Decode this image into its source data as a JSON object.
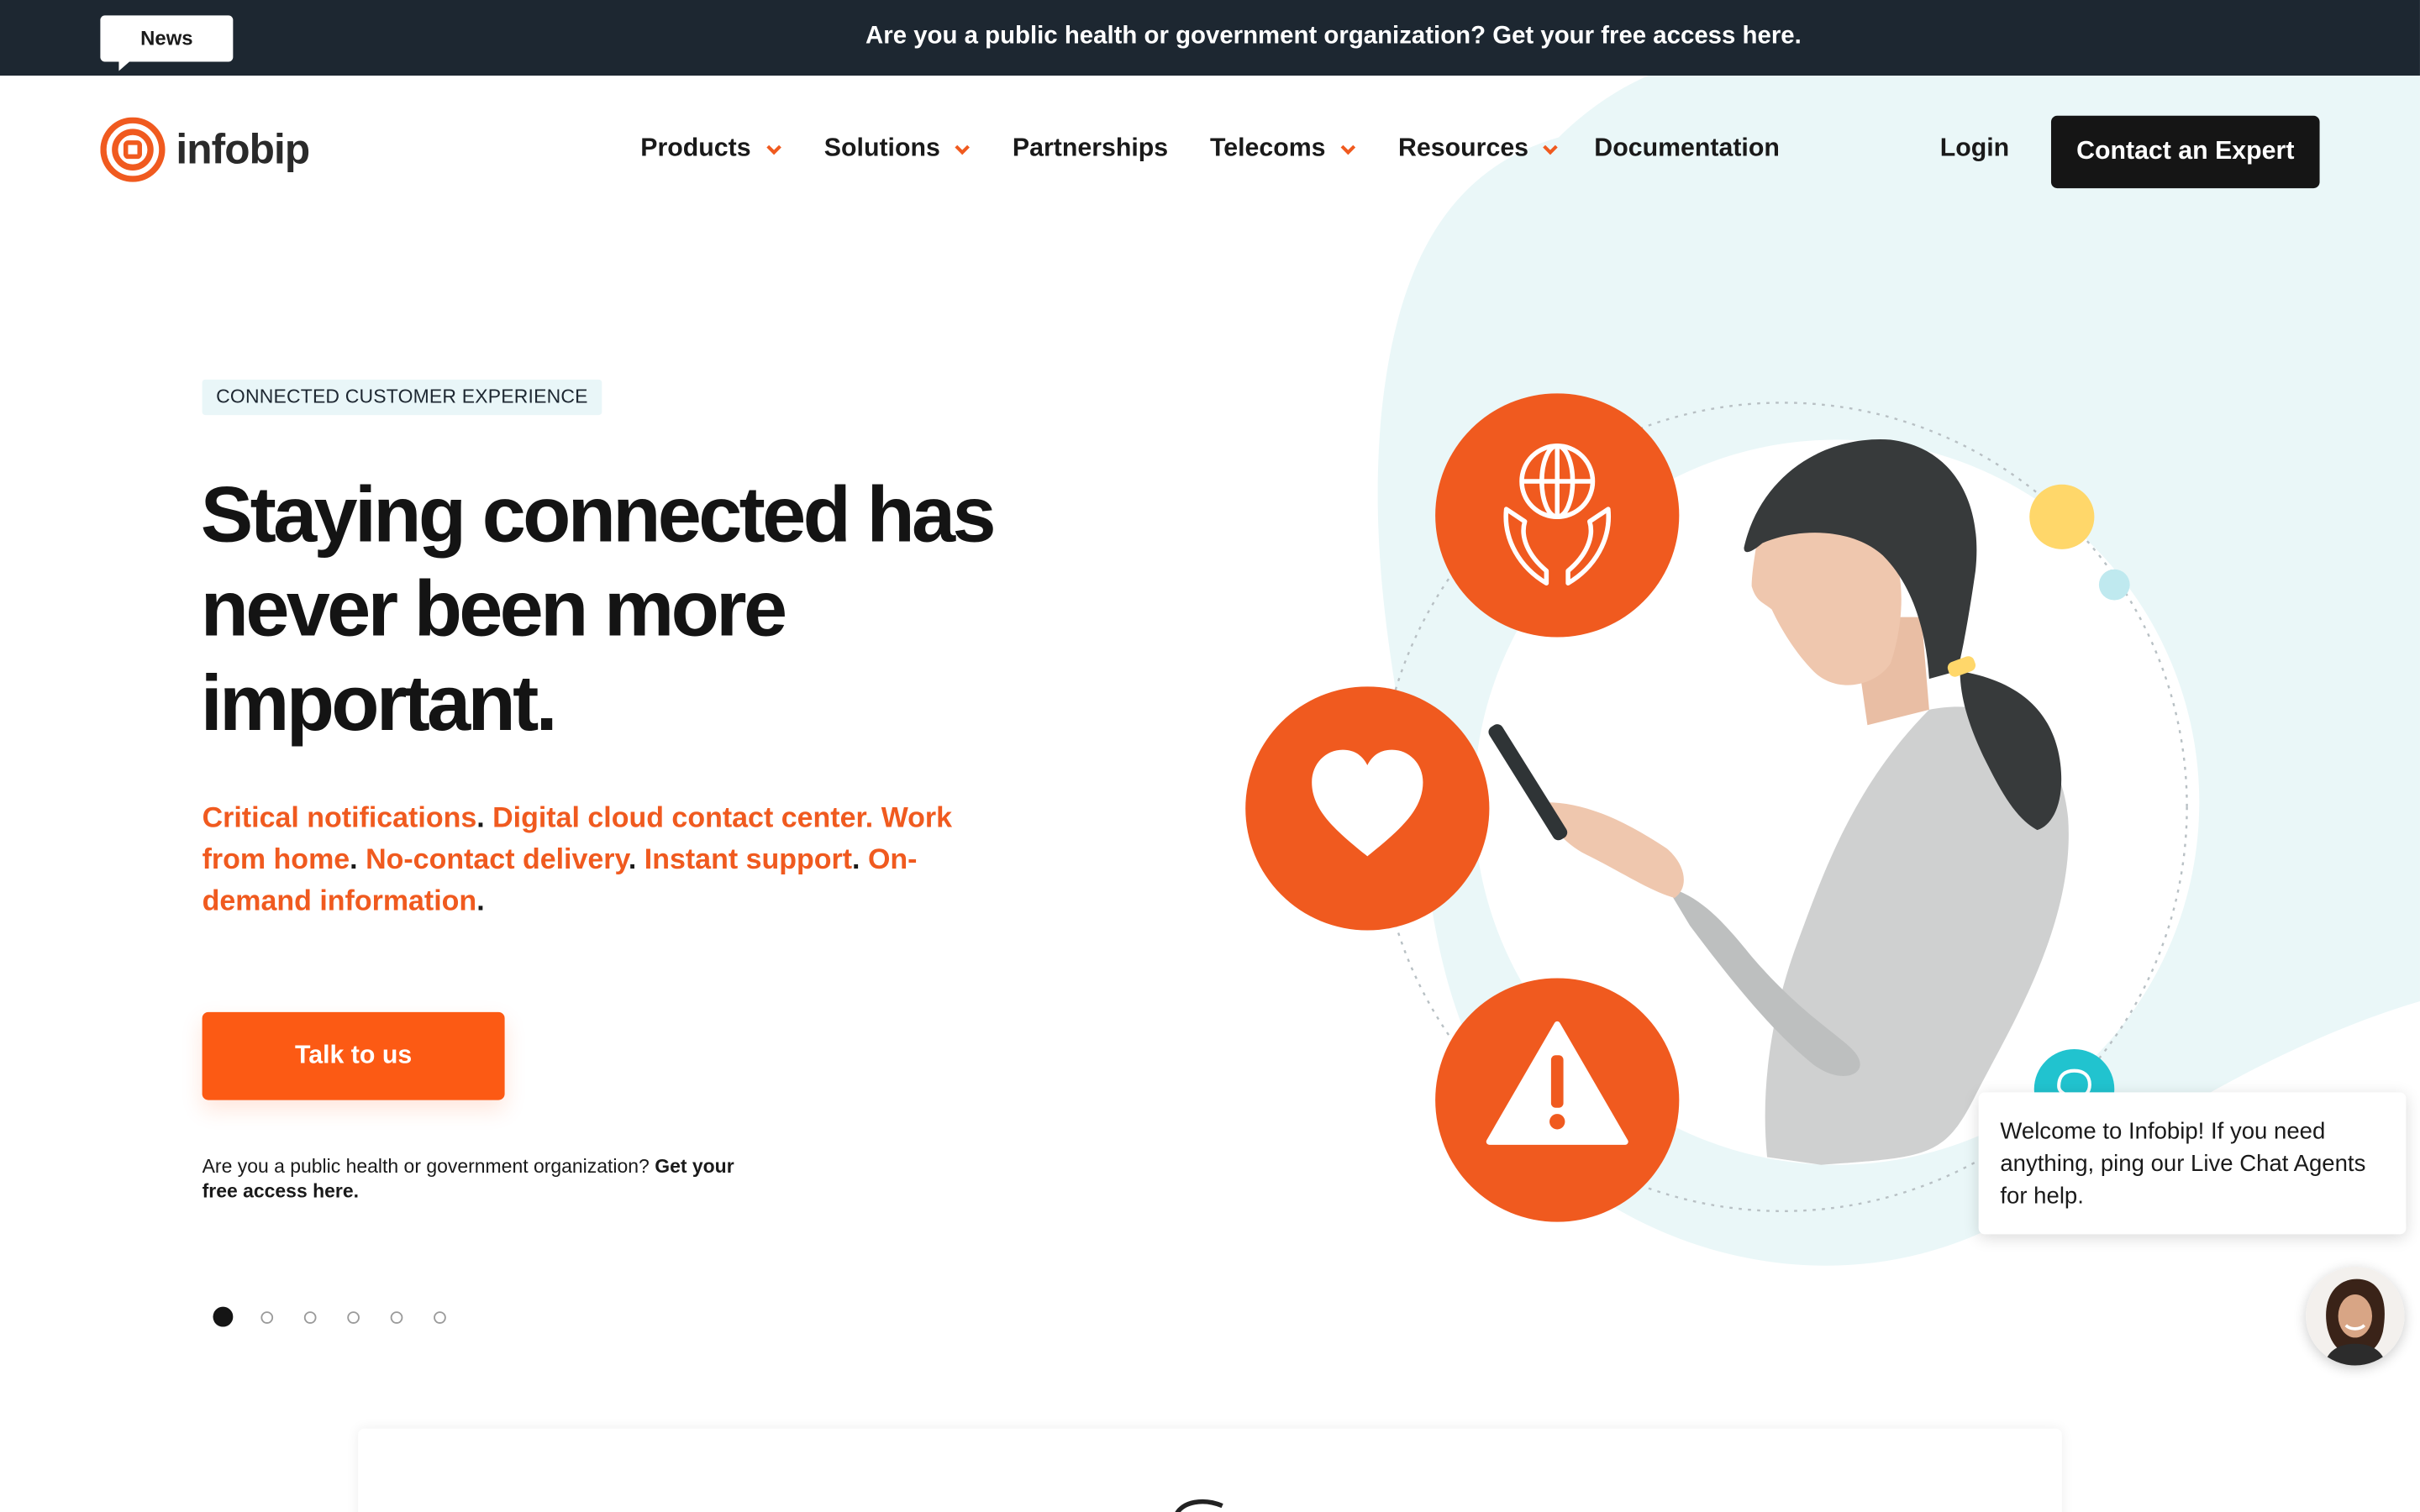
{
  "announcement": {
    "badge": "News",
    "text": "Are you a public health or government organization? Get your free access here."
  },
  "brand": {
    "name": "infobip",
    "accent": "#f05a1f",
    "dark": "#1d2731",
    "teal": "#21c3cf"
  },
  "nav": {
    "items": [
      {
        "label": "Products",
        "has_dropdown": true
      },
      {
        "label": "Solutions",
        "has_dropdown": true
      },
      {
        "label": "Partnerships",
        "has_dropdown": false
      },
      {
        "label": "Telecoms",
        "has_dropdown": true
      },
      {
        "label": "Resources",
        "has_dropdown": true
      },
      {
        "label": "Documentation",
        "has_dropdown": false
      }
    ],
    "login": "Login",
    "cta": "Contact an Expert"
  },
  "hero": {
    "eyebrow": "CONNECTED CUSTOMER EXPERIENCE",
    "headline": "Staying connected has never been more important.",
    "sub": {
      "p1": "Critical notifications",
      "p2": "Digital cloud contact center. Work from home",
      "p3": "No-contact delivery",
      "p4": "Instant support",
      "p5": "On-demand information",
      "sep": "."
    },
    "button": "Talk to us",
    "note_plain": "Are you a public health or government organization? ",
    "note_bold": "Get your free access here."
  },
  "carousel": {
    "slide_count": 6,
    "active_index": 0
  },
  "illustration": {
    "icons": [
      "globe-in-hands-icon",
      "heart-icon",
      "warning-icon"
    ]
  },
  "chat": {
    "message": "Welcome to Infobip! If you need anything, ping our Live Chat Agents for help."
  }
}
